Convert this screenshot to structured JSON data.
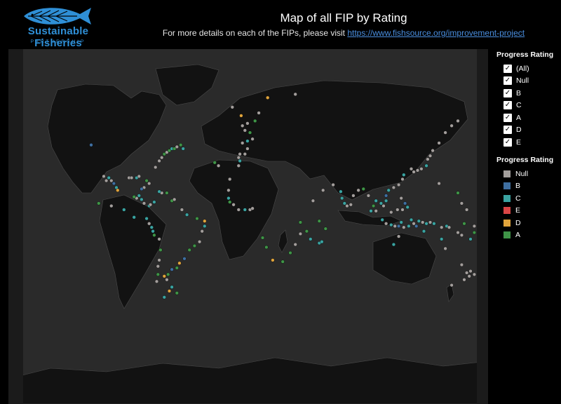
{
  "logo": {
    "brand": "Sustainable Fisheries",
    "tagline": "PARTNERSHIP",
    "icon": "fish-logo-icon",
    "color": "#2f8fd6"
  },
  "header": {
    "title": "Map of all FIP by Rating",
    "subtitle_prefix": "For more details on each of the FIPs, please visit ",
    "link_text": "https://www.fishsource.org/improvement-project"
  },
  "filter": {
    "title": "Progress Rating",
    "items": [
      {
        "label": "(All)",
        "checked": true
      },
      {
        "label": "Null",
        "checked": true
      },
      {
        "label": "B",
        "checked": true
      },
      {
        "label": "C",
        "checked": true
      },
      {
        "label": "A",
        "checked": true
      },
      {
        "label": "D",
        "checked": true
      },
      {
        "label": "E",
        "checked": true
      }
    ]
  },
  "color_legend": {
    "title": "Progress Rating",
    "items": [
      {
        "label": "Null",
        "color": "#a39e9c"
      },
      {
        "label": "B",
        "color": "#3f6fa1"
      },
      {
        "label": "C",
        "color": "#3aa3a1"
      },
      {
        "label": "E",
        "color": "#d94545"
      },
      {
        "label": "D",
        "color": "#e0a43c"
      },
      {
        "label": "A",
        "color": "#3f9447"
      }
    ]
  },
  "map": {
    "land_color": "#121212",
    "ocean_color": "#2a2a2a",
    "border_color": "#5a5a5a",
    "markers": [
      {
        "lon": -126,
        "lat": 49,
        "r": "B"
      },
      {
        "lon": -116,
        "lat": 30,
        "r": "Null"
      },
      {
        "lon": -114,
        "lat": 27,
        "r": "Null"
      },
      {
        "lon": -112,
        "lat": 29,
        "r": "C"
      },
      {
        "lon": -110,
        "lat": 27,
        "r": "Null"
      },
      {
        "lon": -108,
        "lat": 25,
        "r": "B"
      },
      {
        "lon": -106,
        "lat": 22,
        "r": "C"
      },
      {
        "lon": -105,
        "lat": 20,
        "r": "D"
      },
      {
        "lon": -96,
        "lat": 29,
        "r": "Null"
      },
      {
        "lon": -94,
        "lat": 29,
        "r": "Null"
      },
      {
        "lon": -90,
        "lat": 29,
        "r": "C"
      },
      {
        "lon": -88,
        "lat": 30,
        "r": "Null"
      },
      {
        "lon": -84,
        "lat": 22,
        "r": "Null"
      },
      {
        "lon": -86,
        "lat": 21,
        "r": "B"
      },
      {
        "lon": -88,
        "lat": 16,
        "r": "C"
      },
      {
        "lon": -90,
        "lat": 14,
        "r": "Null"
      },
      {
        "lon": -92,
        "lat": 15,
        "r": "A"
      },
      {
        "lon": -86,
        "lat": 13,
        "r": "C"
      },
      {
        "lon": -84,
        "lat": 10,
        "r": "Null"
      },
      {
        "lon": -80,
        "lat": 8,
        "r": "C"
      },
      {
        "lon": -79,
        "lat": 9,
        "r": "Null"
      },
      {
        "lon": -76,
        "lat": 11,
        "r": "C"
      },
      {
        "lon": -70,
        "lat": 18,
        "r": "Null"
      },
      {
        "lon": -72,
        "lat": 19,
        "r": "C"
      },
      {
        "lon": -66,
        "lat": 18,
        "r": "A"
      },
      {
        "lon": -62,
        "lat": 12,
        "r": "A"
      },
      {
        "lon": -60,
        "lat": 13,
        "r": "Null"
      },
      {
        "lon": -75,
        "lat": 36,
        "r": "Null"
      },
      {
        "lon": -72,
        "lat": 40,
        "r": "Null"
      },
      {
        "lon": -70,
        "lat": 42,
        "r": "Null"
      },
      {
        "lon": -68,
        "lat": 44,
        "r": "A"
      },
      {
        "lon": -66,
        "lat": 45,
        "r": "Null"
      },
      {
        "lon": -64,
        "lat": 46,
        "r": "A"
      },
      {
        "lon": -62,
        "lat": 47,
        "r": "C"
      },
      {
        "lon": -60,
        "lat": 47,
        "r": "A"
      },
      {
        "lon": -58,
        "lat": 48,
        "r": "Null"
      },
      {
        "lon": -55,
        "lat": 49,
        "r": "A"
      },
      {
        "lon": -53,
        "lat": 47,
        "r": "C"
      },
      {
        "lon": -82,
        "lat": 27,
        "r": "A"
      },
      {
        "lon": -80,
        "lat": 25,
        "r": "Null"
      },
      {
        "lon": -120,
        "lat": 10,
        "r": "A"
      },
      {
        "lon": -110,
        "lat": 8,
        "r": "Null"
      },
      {
        "lon": -100,
        "lat": 5,
        "r": "C"
      },
      {
        "lon": -92,
        "lat": -1,
        "r": "C"
      },
      {
        "lon": -82,
        "lat": -2,
        "r": "C"
      },
      {
        "lon": -80,
        "lat": -6,
        "r": "Null"
      },
      {
        "lon": -78,
        "lat": -9,
        "r": "C"
      },
      {
        "lon": -77,
        "lat": -12,
        "r": "C"
      },
      {
        "lon": -76,
        "lat": -15,
        "r": "A"
      },
      {
        "lon": -72,
        "lat": -18,
        "r": "Null"
      },
      {
        "lon": -71,
        "lat": -26,
        "r": "A"
      },
      {
        "lon": -72,
        "lat": -33,
        "r": "Null"
      },
      {
        "lon": -73,
        "lat": -37,
        "r": "Null"
      },
      {
        "lon": -73,
        "lat": -42,
        "r": "A"
      },
      {
        "lon": -74,
        "lat": -46,
        "r": "Null"
      },
      {
        "lon": -68,
        "lat": -43,
        "r": "D"
      },
      {
        "lon": -66,
        "lat": -45,
        "r": "Null"
      },
      {
        "lon": -65,
        "lat": -42,
        "r": "A"
      },
      {
        "lon": -62,
        "lat": -39,
        "r": "B"
      },
      {
        "lon": -58,
        "lat": -38,
        "r": "A"
      },
      {
        "lon": -56,
        "lat": -35,
        "r": "D"
      },
      {
        "lon": -52,
        "lat": -32,
        "r": "B"
      },
      {
        "lon": -48,
        "lat": -26,
        "r": "A"
      },
      {
        "lon": -44,
        "lat": -23,
        "r": "A"
      },
      {
        "lon": -40,
        "lat": -20,
        "r": "Null"
      },
      {
        "lon": -38,
        "lat": -12,
        "r": "Null"
      },
      {
        "lon": -36,
        "lat": -8,
        "r": "C"
      },
      {
        "lon": -36,
        "lat": -4,
        "r": "D"
      },
      {
        "lon": -42,
        "lat": -2,
        "r": "A"
      },
      {
        "lon": -50,
        "lat": 1,
        "r": "C"
      },
      {
        "lon": -54,
        "lat": 5,
        "r": "Null"
      },
      {
        "lon": -68,
        "lat": -54,
        "r": "C"
      },
      {
        "lon": -64,
        "lat": -51,
        "r": "D"
      },
      {
        "lon": -58,
        "lat": -52,
        "r": "A"
      },
      {
        "lon": -62,
        "lat": -49,
        "r": "C"
      },
      {
        "lon": -28,
        "lat": 39,
        "r": "A"
      },
      {
        "lon": -25,
        "lat": 37,
        "r": "Null"
      },
      {
        "lon": -16,
        "lat": 28,
        "r": "Null"
      },
      {
        "lon": -17,
        "lat": 20,
        "r": "Null"
      },
      {
        "lon": -17,
        "lat": 14,
        "r": "C"
      },
      {
        "lon": -16,
        "lat": 11,
        "r": "A"
      },
      {
        "lon": -13,
        "lat": 9,
        "r": "Null"
      },
      {
        "lon": -9,
        "lat": 5,
        "r": "Null"
      },
      {
        "lon": -4,
        "lat": 5,
        "r": "C"
      },
      {
        "lon": 0,
        "lat": 5,
        "r": "Null"
      },
      {
        "lon": 2,
        "lat": 6,
        "r": "Null"
      },
      {
        "lon": -9,
        "lat": 37,
        "r": "Null"
      },
      {
        "lon": -8,
        "lat": 40,
        "r": "C"
      },
      {
        "lon": -9,
        "lat": 42,
        "r": "Null"
      },
      {
        "lon": -8,
        "lat": 44,
        "r": "Null"
      },
      {
        "lon": -4,
        "lat": 44,
        "r": "Null"
      },
      {
        "lon": -2,
        "lat": 47,
        "r": "Null"
      },
      {
        "lon": -6,
        "lat": 50,
        "r": "Null"
      },
      {
        "lon": -2,
        "lat": 51,
        "r": "C"
      },
      {
        "lon": 2,
        "lat": 52,
        "r": "Null"
      },
      {
        "lon": 0,
        "lat": 55,
        "r": "A"
      },
      {
        "lon": -4,
        "lat": 56,
        "r": "Null"
      },
      {
        "lon": -6,
        "lat": 58,
        "r": "Null"
      },
      {
        "lon": -2,
        "lat": 59,
        "r": "Null"
      },
      {
        "lon": -7,
        "lat": 62,
        "r": "D"
      },
      {
        "lon": -14,
        "lat": 65,
        "r": "Null"
      },
      {
        "lon": 4,
        "lat": 60,
        "r": "A"
      },
      {
        "lon": 7,
        "lat": 63,
        "r": "Null"
      },
      {
        "lon": 14,
        "lat": 68,
        "r": "D"
      },
      {
        "lon": 36,
        "lat": 69,
        "r": "Null"
      },
      {
        "lon": 10,
        "lat": -17,
        "r": "A"
      },
      {
        "lon": 13,
        "lat": -24,
        "r": "A"
      },
      {
        "lon": 18,
        "lat": -33,
        "r": "D"
      },
      {
        "lon": 26,
        "lat": -34,
        "r": "A"
      },
      {
        "lon": 32,
        "lat": -28,
        "r": "A"
      },
      {
        "lon": 36,
        "lat": -22,
        "r": "Null"
      },
      {
        "lon": 40,
        "lat": -14,
        "r": "Null"
      },
      {
        "lon": 40,
        "lat": -5,
        "r": "A"
      },
      {
        "lon": 45,
        "lat": -12,
        "r": "A"
      },
      {
        "lon": 48,
        "lat": -18,
        "r": "C"
      },
      {
        "lon": 55,
        "lat": -21,
        "r": "C"
      },
      {
        "lon": 57,
        "lat": -20,
        "r": "C"
      },
      {
        "lon": 60,
        "lat": -10,
        "r": "A"
      },
      {
        "lon": 55,
        "lat": -4,
        "r": "A"
      },
      {
        "lon": 50,
        "lat": 12,
        "r": "Null"
      },
      {
        "lon": 58,
        "lat": 20,
        "r": "Null"
      },
      {
        "lon": 66,
        "lat": 24,
        "r": "Null"
      },
      {
        "lon": 72,
        "lat": 19,
        "r": "C"
      },
      {
        "lon": 73,
        "lat": 14,
        "r": "C"
      },
      {
        "lon": 75,
        "lat": 10,
        "r": "C"
      },
      {
        "lon": 77,
        "lat": 8,
        "r": "Null"
      },
      {
        "lon": 80,
        "lat": 9,
        "r": "Null"
      },
      {
        "lon": 82,
        "lat": 16,
        "r": "Null"
      },
      {
        "lon": 86,
        "lat": 20,
        "r": "Null"
      },
      {
        "lon": 90,
        "lat": 21,
        "r": "A"
      },
      {
        "lon": 94,
        "lat": 16,
        "r": "Null"
      },
      {
        "lon": 98,
        "lat": 8,
        "r": "A"
      },
      {
        "lon": 100,
        "lat": 4,
        "r": "Null"
      },
      {
        "lon": 96,
        "lat": 4,
        "r": "C"
      },
      {
        "lon": 100,
        "lat": 12,
        "r": "C"
      },
      {
        "lon": 104,
        "lat": 10,
        "r": "C"
      },
      {
        "lon": 106,
        "lat": 8,
        "r": "Null"
      },
      {
        "lon": 108,
        "lat": 12,
        "r": "C"
      },
      {
        "lon": 108,
        "lat": 16,
        "r": "B"
      },
      {
        "lon": 110,
        "lat": 20,
        "r": "C"
      },
      {
        "lon": 114,
        "lat": 22,
        "r": "Null"
      },
      {
        "lon": 118,
        "lat": 24,
        "r": "Null"
      },
      {
        "lon": 121,
        "lat": 28,
        "r": "Null"
      },
      {
        "lon": 122,
        "lat": 31,
        "r": "C"
      },
      {
        "lon": 120,
        "lat": 14,
        "r": "Null"
      },
      {
        "lon": 123,
        "lat": 10,
        "r": "B"
      },
      {
        "lon": 125,
        "lat": 7,
        "r": "C"
      },
      {
        "lon": 121,
        "lat": 5,
        "r": "Null"
      },
      {
        "lon": 117,
        "lat": 5,
        "r": "Null"
      },
      {
        "lon": 112,
        "lat": 3,
        "r": "Null"
      },
      {
        "lon": 105,
        "lat": -3,
        "r": "C"
      },
      {
        "lon": 108,
        "lat": -6,
        "r": "Null"
      },
      {
        "lon": 112,
        "lat": -7,
        "r": "C"
      },
      {
        "lon": 115,
        "lat": -8,
        "r": "Null"
      },
      {
        "lon": 118,
        "lat": -8,
        "r": "B"
      },
      {
        "lon": 120,
        "lat": -5,
        "r": "C"
      },
      {
        "lon": 122,
        "lat": -9,
        "r": "Null"
      },
      {
        "lon": 126,
        "lat": -8,
        "r": "C"
      },
      {
        "lon": 128,
        "lat": -3,
        "r": "C"
      },
      {
        "lon": 130,
        "lat": -6,
        "r": "Null"
      },
      {
        "lon": 132,
        "lat": -8,
        "r": "B"
      },
      {
        "lon": 134,
        "lat": -4,
        "r": "C"
      },
      {
        "lon": 137,
        "lat": -5,
        "r": "Null"
      },
      {
        "lon": 140,
        "lat": -6,
        "r": "C"
      },
      {
        "lon": 143,
        "lat": -5,
        "r": "Null"
      },
      {
        "lon": 146,
        "lat": -6,
        "r": "C"
      },
      {
        "lon": 118,
        "lat": -16,
        "r": "Null"
      },
      {
        "lon": 114,
        "lat": -22,
        "r": "C"
      },
      {
        "lon": 138,
        "lat": -12,
        "r": "C"
      },
      {
        "lon": 152,
        "lat": -9,
        "r": "Null"
      },
      {
        "lon": 156,
        "lat": -8,
        "r": "C"
      },
      {
        "lon": 128,
        "lat": 35,
        "r": "Null"
      },
      {
        "lon": 130,
        "lat": 33,
        "r": "Null"
      },
      {
        "lon": 133,
        "lat": 34,
        "r": "Null"
      },
      {
        "lon": 136,
        "lat": 35,
        "r": "Null"
      },
      {
        "lon": 140,
        "lat": 37,
        "r": "C"
      },
      {
        "lon": 141,
        "lat": 41,
        "r": "Null"
      },
      {
        "lon": 143,
        "lat": 43,
        "r": "Null"
      },
      {
        "lon": 145,
        "lat": 46,
        "r": "Null"
      },
      {
        "lon": 150,
        "lat": 50,
        "r": "Null"
      },
      {
        "lon": 155,
        "lat": 55,
        "r": "Null"
      },
      {
        "lon": 160,
        "lat": 58,
        "r": "Null"
      },
      {
        "lon": 165,
        "lat": 60,
        "r": "Null"
      },
      {
        "lon": 150,
        "lat": 25,
        "r": "Null"
      },
      {
        "lon": 165,
        "lat": 18,
        "r": "A"
      },
      {
        "lon": 168,
        "lat": 10,
        "r": "Null"
      },
      {
        "lon": 172,
        "lat": 5,
        "r": "Null"
      },
      {
        "lon": 178,
        "lat": -8,
        "r": "Null"
      },
      {
        "lon": 170,
        "lat": -6,
        "r": "A"
      },
      {
        "lon": 165,
        "lat": -13,
        "r": "Null"
      },
      {
        "lon": 168,
        "lat": -15,
        "r": "Null"
      },
      {
        "lon": 175,
        "lat": -18,
        "r": "C"
      },
      {
        "lon": 178,
        "lat": -13,
        "r": "A"
      },
      {
        "lon": 158,
        "lat": -9,
        "r": "Null"
      },
      {
        "lon": 152,
        "lat": -18,
        "r": "C"
      },
      {
        "lon": 155,
        "lat": -25,
        "r": "Null"
      },
      {
        "lon": 168,
        "lat": -36,
        "r": "Null"
      },
      {
        "lon": 172,
        "lat": -41,
        "r": "Null"
      },
      {
        "lon": 174,
        "lat": -43,
        "r": "Null"
      },
      {
        "lon": 170,
        "lat": -45,
        "r": "Null"
      },
      {
        "lon": 175,
        "lat": -40,
        "r": "Null"
      },
      {
        "lon": 178,
        "lat": -42,
        "r": "Null"
      },
      {
        "lon": 160,
        "lat": -48,
        "r": "Null"
      }
    ]
  }
}
